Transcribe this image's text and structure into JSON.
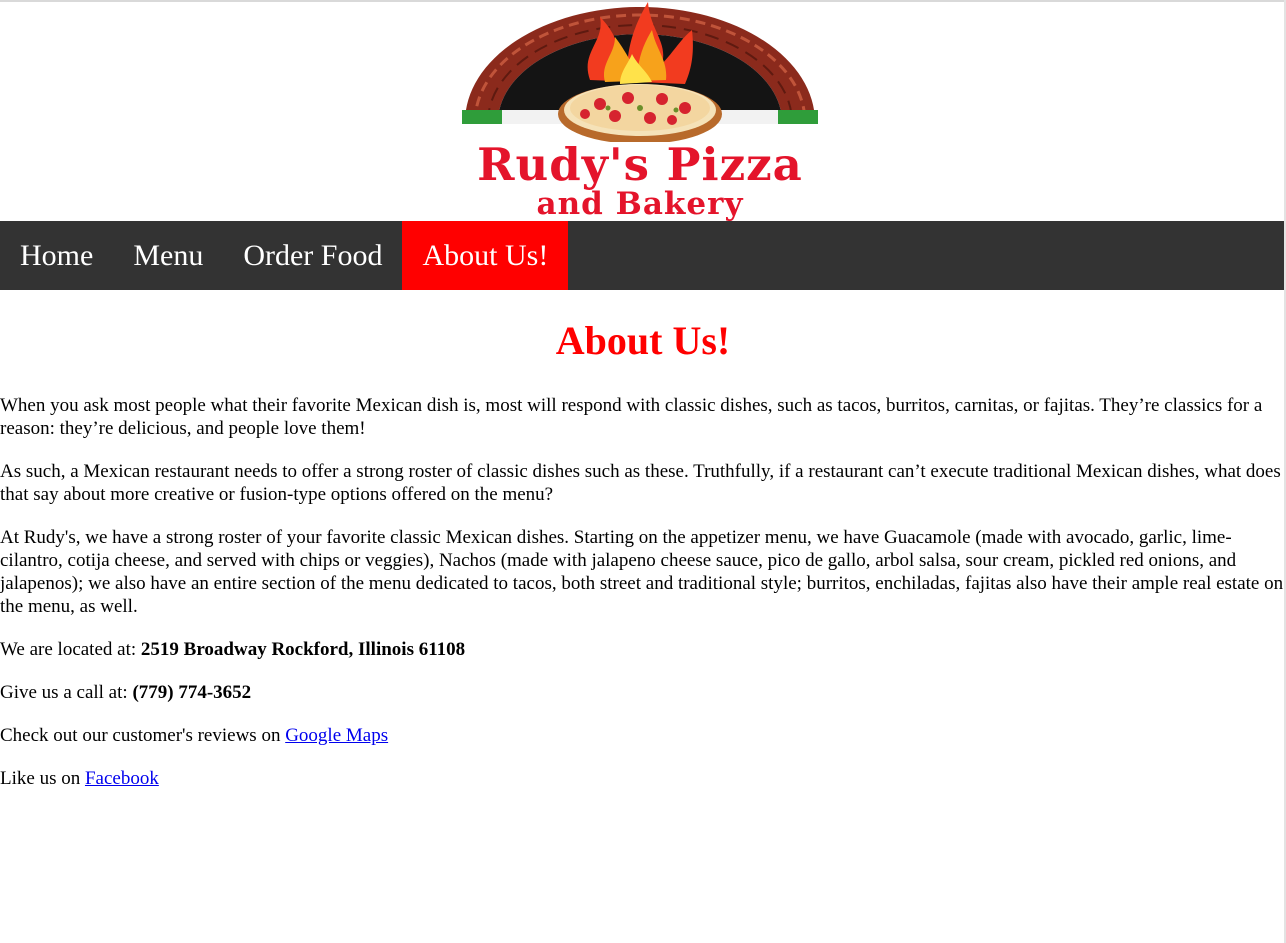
{
  "logo": {
    "line1": "Rudy's Pizza",
    "line2": "and Bakery",
    "colors": {
      "brand_red": "#e4142b",
      "brick": "#8b2a1c",
      "flame": "#f7a21b"
    }
  },
  "nav": {
    "items": [
      {
        "label": "Home",
        "active": false
      },
      {
        "label": "Menu",
        "active": false
      },
      {
        "label": "Order Food",
        "active": false
      },
      {
        "label": "About Us!",
        "active": true
      }
    ],
    "bg_color": "#333333",
    "active_color": "#ff0000"
  },
  "page": {
    "title": "About Us!",
    "paragraphs": [
      "When you ask most people what their favorite Mexican dish is, most will respond with classic dishes, such as tacos, burritos, carnitas, or fajitas. They’re classics for a reason: they’re delicious, and people love them!",
      "As such, a Mexican restaurant needs to offer a strong roster of classic dishes such as these. Truthfully, if a restaurant can’t execute traditional Mexican dishes, what does that say about more creative or fusion-type options offered on the menu?",
      "At Rudy's, we have a strong roster of your favorite classic Mexican dishes. Starting on the appetizer menu, we have Guacamole (made with avocado, garlic, lime-cilantro, cotija cheese, and served with chips or veggies), Nachos (made with jalapeno cheese sauce, pico de gallo, arbol salsa, sour cream, pickled red onions, and jalapenos); we also have an entire section of the menu dedicated to tacos, both street and traditional style; burritos, enchiladas, fajitas also have their ample real estate on the menu, as well."
    ],
    "location_label": "We are located at:",
    "address": "2519 Broadway Rockford, Illinois 61108",
    "call_label": "Give us a call at:",
    "phone": "(779) 774-3652",
    "reviews_label": "Check out our customer's reviews on",
    "reviews_link": "Google Maps",
    "like_label": "Like us on",
    "facebook_link": "Facebook"
  }
}
